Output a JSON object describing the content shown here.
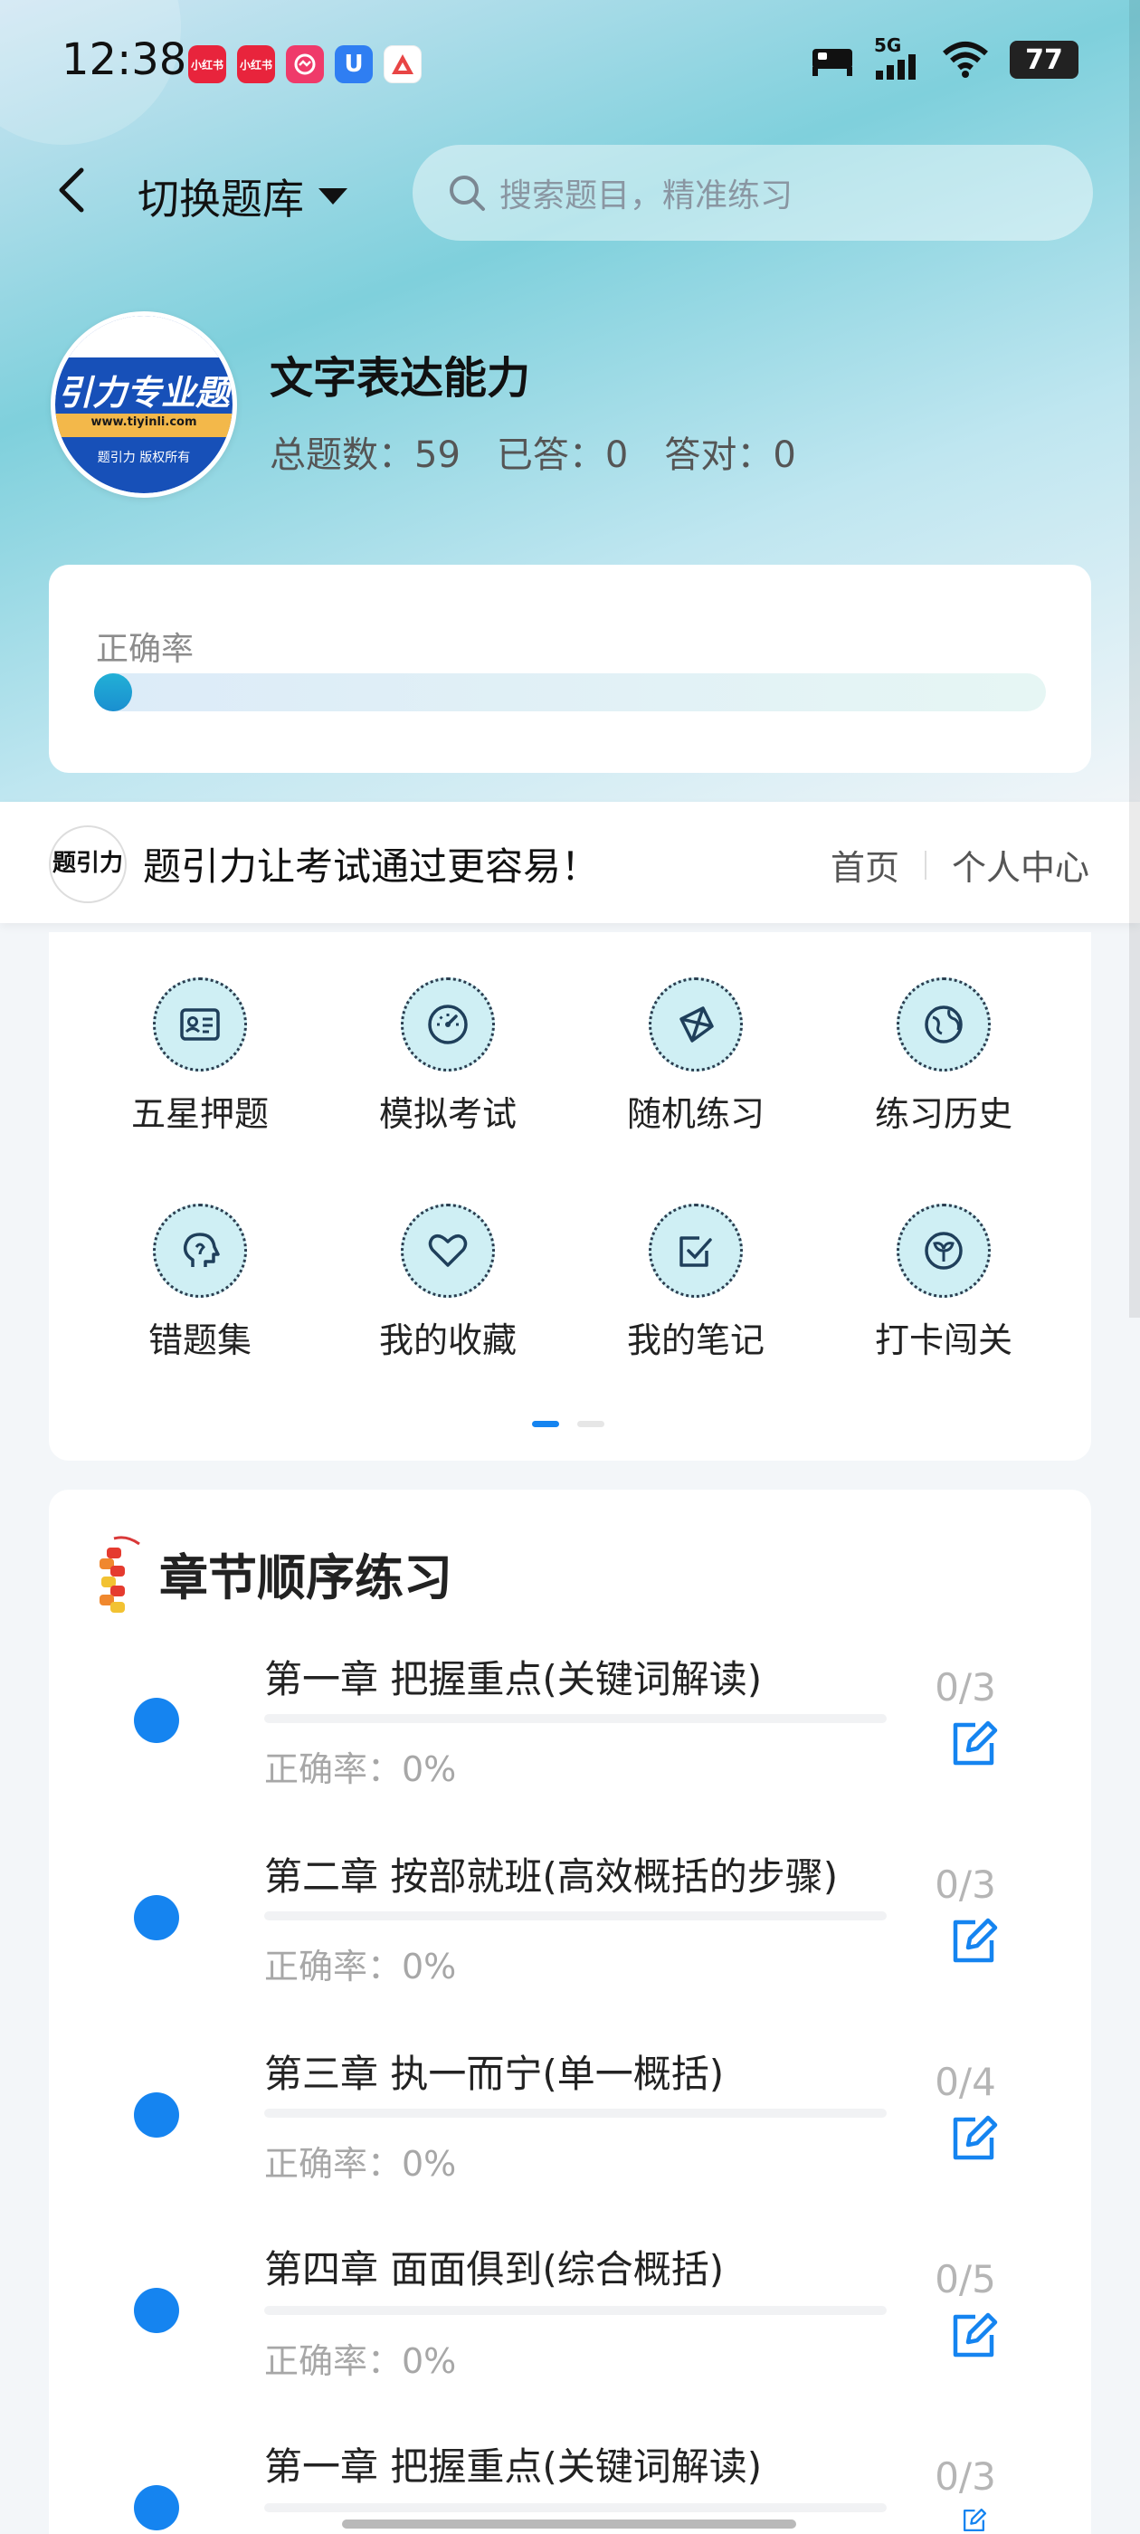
{
  "status_bar": {
    "time": "12:38",
    "network": "5G",
    "battery": "77",
    "app_icons": [
      {
        "name": "xiaohongshu",
        "label": "小红书",
        "color": "#e8243c"
      },
      {
        "name": "xiaohongshu",
        "label": "小红书",
        "color": "#e8243c"
      },
      {
        "name": "app-pink",
        "label": "",
        "color": "#ef3a6a"
      },
      {
        "name": "app-blue",
        "label": "U",
        "color": "#2f7ef2"
      },
      {
        "name": "app-red",
        "label": "",
        "color": "#e84545"
      }
    ]
  },
  "header": {
    "switch_label": "切换题库",
    "search_placeholder": "搜索题目，精准练习"
  },
  "bank": {
    "logo_text": "引力专业题",
    "logo_url": "www.tiyinli.com",
    "logo_copyright": "题引力 版权所有",
    "title": "文字表达能力",
    "stats": {
      "total": "总题数：59",
      "answered": "已答：0",
      "correct": "答对：0"
    }
  },
  "accuracy": {
    "label": "正确率",
    "value": 0
  },
  "banner": {
    "logo_text": "题引力",
    "slogan": "题引力让考试通过更容易！",
    "links": [
      "首页",
      "个人中心"
    ]
  },
  "features": [
    {
      "label": "五星押题",
      "icon": "id-card-icon"
    },
    {
      "label": "模拟考试",
      "icon": "speedometer-icon"
    },
    {
      "label": "随机练习",
      "icon": "network-icon"
    },
    {
      "label": "练习历史",
      "icon": "globe-icon"
    },
    {
      "label": "错题集",
      "icon": "head-icon"
    },
    {
      "label": "我的收藏",
      "icon": "heart-icon"
    },
    {
      "label": "我的笔记",
      "icon": "check-note-icon"
    },
    {
      "label": "打卡闯关",
      "icon": "leaf-icon"
    }
  ],
  "pager": {
    "active": 0,
    "count": 2
  },
  "chapters": {
    "title": "章节顺序练习",
    "items": [
      {
        "name": "第一章 把握重点(关键词解读)",
        "accuracy": "正确率：0%",
        "count": "0/3"
      },
      {
        "name": "第二章 按部就班(高效概括的步骤)",
        "accuracy": "正确率：0%",
        "count": "0/3"
      },
      {
        "name": "第三章 执一而宁(单一概括)",
        "accuracy": "正确率：0%",
        "count": "0/4"
      },
      {
        "name": "第四章 面面俱到(综合概括)",
        "accuracy": "正确率：0%",
        "count": "0/5"
      },
      {
        "name": "第一章 把握重点(关键词解读)",
        "accuracy": "",
        "count": "0/3"
      }
    ]
  },
  "colors": {
    "accent": "#1584f0",
    "icon_bg": "#cfeff4",
    "muted": "#a7a7a7"
  }
}
